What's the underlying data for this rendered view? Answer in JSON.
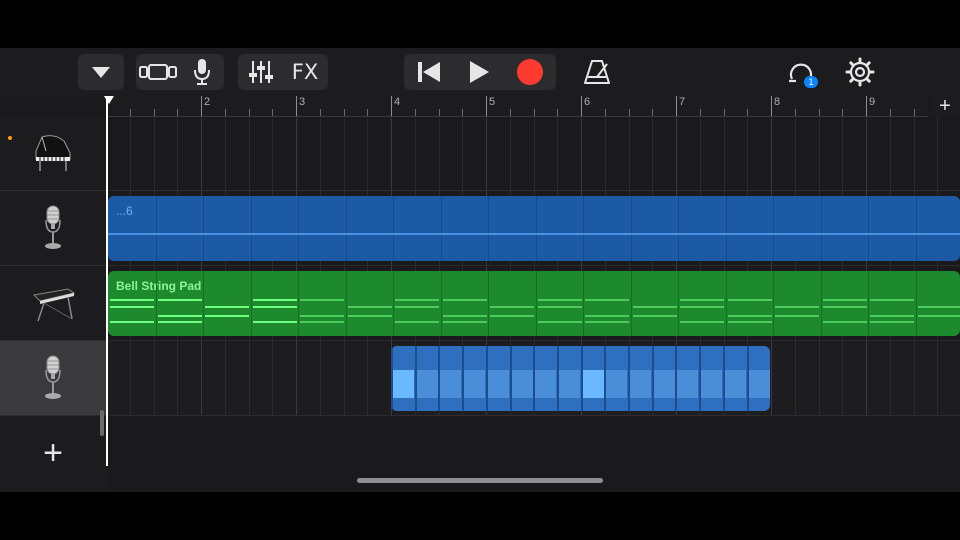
{
  "toolbar": {
    "fx_label": "FX",
    "icons": [
      "dropdown-icon",
      "tracks-view-icon",
      "mic-icon",
      "mixer-icon",
      "rewind-icon",
      "play-icon",
      "record-icon",
      "metronome-icon",
      "loop-browser-icon",
      "settings-icon"
    ],
    "loop_badge": "1",
    "record_color": "#ff3b30"
  },
  "ruler": {
    "bars": [
      "2",
      "3",
      "4",
      "5",
      "6",
      "7",
      "8",
      "9"
    ],
    "add_label": "+"
  },
  "tracks": [
    {
      "instrument": "grand-piano-icon",
      "name_dot": true,
      "selected": false
    },
    {
      "instrument": "microphone-icon",
      "selected": false
    },
    {
      "instrument": "keyboard-synth-icon",
      "selected": false
    },
    {
      "instrument": "microphone-icon",
      "selected": true
    }
  ],
  "regions": {
    "audio_top_label": "...6",
    "synth_label": "Bell String Pad",
    "audio_color": "#1c5aa6",
    "synth_color": "#1e8a2e",
    "recorded_color": "#2f6fbf"
  },
  "add_track_label": "+"
}
